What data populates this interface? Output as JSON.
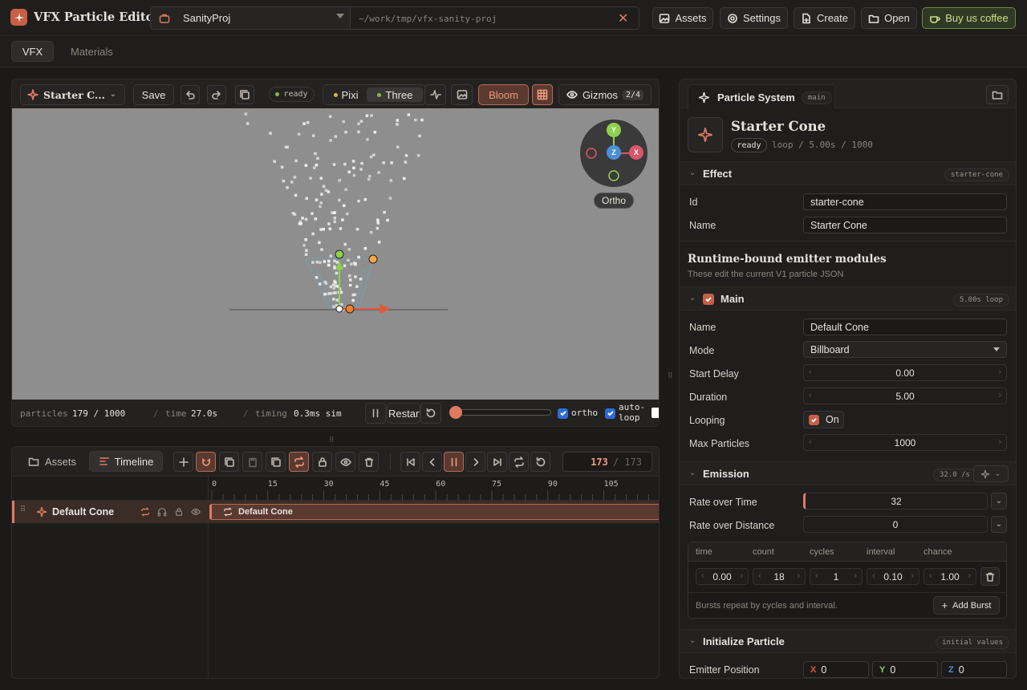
{
  "app": {
    "title": "VFX Particle Editor",
    "project": "SanityProj",
    "path": "~/work/tmp/vfx-sanity-proj",
    "assets": "Assets",
    "settings": "Settings",
    "create": "Create",
    "open": "Open",
    "coffee": "Buy us coffee"
  },
  "tabs": {
    "vfx": "VFX",
    "materials": "Materials"
  },
  "viewport": {
    "effect_name": "Starter C...",
    "save": "Save",
    "status": "ready",
    "pixi": "Pixi",
    "three": "Three",
    "bloom": "Bloom",
    "gizmos": "Gizmos",
    "gizmos_count": "2/4",
    "ortho_label": "Ortho",
    "axis_y": "Y",
    "axis_z": "Z",
    "axis_x": "X"
  },
  "stats": {
    "particles_label": "particles",
    "particles": "179 / 1000",
    "time_label": "time",
    "time": "27.0s",
    "timing_label": "timing",
    "timing": "0.3ms sim",
    "restart": "Restart",
    "ortho": "ortho",
    "autoloop": "auto-loop"
  },
  "timeline": {
    "assets_tab": "Assets",
    "timeline_tab": "Timeline",
    "frame": "173",
    "frame_total": "/ 173",
    "ticks": [
      "0",
      "15",
      "30",
      "45",
      "60",
      "75",
      "90",
      "105"
    ],
    "track_name": "Default Cone",
    "clip_name": "Default Cone"
  },
  "inspector": {
    "tab": "Particle System",
    "tab_tag": "main",
    "title": "Starter Cone",
    "status": "ready",
    "meta": "loop / 5.00s / 1000",
    "effect": {
      "title": "Effect",
      "tag": "starter-cone",
      "id_label": "Id",
      "id": "starter-cone",
      "name_label": "Name",
      "name": "Starter Cone"
    },
    "modules_title": "Runtime-bound emitter modules",
    "modules_sub": "These edit the current V1 particle JSON",
    "main": {
      "title": "Main",
      "tag": "5.00s loop",
      "name_label": "Name",
      "name": "Default Cone",
      "mode_label": "Mode",
      "mode": "Billboard",
      "delay_label": "Start Delay",
      "delay": "0.00",
      "duration_label": "Duration",
      "duration": "5.00",
      "looping_label": "Looping",
      "looping": "On",
      "max_label": "Max Particles",
      "max": "1000"
    },
    "emission": {
      "title": "Emission",
      "tag": "32.0 /s",
      "rot_label": "Rate over Time",
      "rot": "32",
      "rod_label": "Rate over Distance",
      "rod": "0",
      "burst_headers": [
        "time",
        "count",
        "cycles",
        "interval",
        "chance"
      ],
      "burst_values": [
        "0.00",
        "18",
        "1",
        "0.10",
        "1.00"
      ],
      "note": "Bursts repeat by cycles and interval.",
      "add_burst": "Add Burst"
    },
    "init": {
      "title": "Initialize Particle",
      "tag": "initial values",
      "pos_label": "Emitter Position",
      "x_label": "X",
      "x": "0",
      "y_label": "Y",
      "y": "0",
      "z_label": "Z",
      "z": "0"
    }
  },
  "colors": {
    "accent": "#e07a5f",
    "green": "#8fd14f",
    "orange": "#f4a742",
    "blue": "#4a90d9",
    "red": "#d9556a"
  }
}
